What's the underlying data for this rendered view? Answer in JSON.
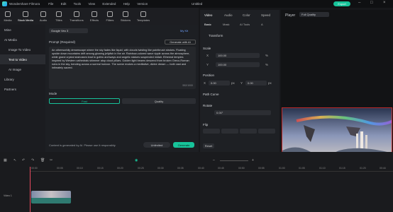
{
  "titlebar": {
    "app": "Wondershare Filmora",
    "menu": [
      "File",
      "Edit",
      "Tools",
      "View",
      "Extended",
      "Help",
      "Version"
    ],
    "project": "Untitled",
    "export_label": "Export"
  },
  "media_tabs": [
    {
      "label": "Media"
    },
    {
      "label": "Stock Media"
    },
    {
      "label": "Audio"
    },
    {
      "label": "Titles"
    },
    {
      "label": "Transitions"
    },
    {
      "label": "Effects"
    },
    {
      "label": "Filters"
    },
    {
      "label": "Stickers"
    },
    {
      "label": "Templates"
    }
  ],
  "sidebar": {
    "items": [
      {
        "label": "Mine"
      },
      {
        "label": "AI Media"
      },
      {
        "label": "Image To Video"
      },
      {
        "label": "Text to Video"
      },
      {
        "label": "AI Image"
      },
      {
        "label": "Library"
      },
      {
        "label": "Partners"
      }
    ]
  },
  "center": {
    "model": "Google Veo 3",
    "mykit": "My Kit",
    "prompt_label": "Prompt (Required)",
    "gen_ai": "Generate with AI",
    "prompt_text": "An otherworldly dreamscape where the sky fades like liquid, with clouds twisting like paintbrush strokes. Floating upside down mountains drift among glowing jellyfish in the air. Rainbow-colored wave ripple across the atmosphere, while grand crystal staircases lead to gothic archways and angelic statues suspended midair. Ethereal temples inspired by Western cathedrals shimmer atop cloud pillars. Golden light beams descend from broken Greco-Roman ruins in the sky, bending across a surreal horizon. The scene evokes a meditative, divine dream — both vast and intimately sacred.",
    "count": "552/1000",
    "mode_label": "Mode",
    "mode_fast": "Fast",
    "mode_quality": "Quality",
    "disclaimer": "Content is generated by AI. Please use it responsibly.",
    "unlimited": "Unlimited",
    "generate": "Generate"
  },
  "props": {
    "tabs": [
      "Video",
      "Audio",
      "Color",
      "Speed"
    ],
    "subtabs": [
      "Basic",
      "Mask",
      "AI Tools",
      "A"
    ],
    "transform": "Transform",
    "scale": "Scale",
    "x_label": "X",
    "y_label": "Y",
    "scale_x": "100.00",
    "scale_y": "100.00",
    "pct": "%",
    "position": "Position",
    "pos_x": "0.00",
    "pos_y": "0.00",
    "px": "px",
    "path_curve": "Path Curve",
    "rotate": "Rotate",
    "rotate_val": "0.00°",
    "flip": "Flip",
    "reset": "Reset"
  },
  "preview": {
    "player": "Player",
    "quality": "Full Quality"
  },
  "timeline": {
    "ticks": [
      "00:00",
      "00:05",
      "00:10",
      "00:15",
      "00:20",
      "00:25",
      "00:30",
      "00:35",
      "00:40",
      "00:45",
      "00:50",
      "00:55",
      "01:00",
      "01:05",
      "01:10",
      "01:15",
      "01:20",
      "00:44"
    ],
    "track": "Video 1"
  }
}
